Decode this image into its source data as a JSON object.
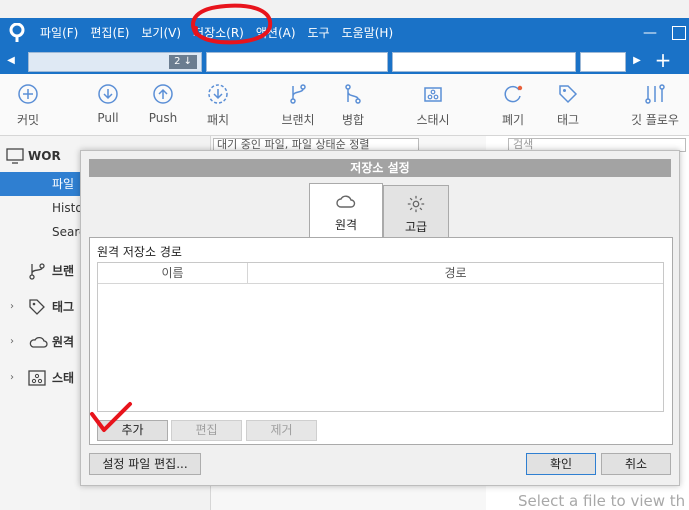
{
  "menu": [
    "파일(F)",
    "편집(E)",
    "보기(V)",
    "저장소(R)",
    "액션(A)",
    "도구",
    "도움말(H)"
  ],
  "window_controls": {
    "minimize": "—"
  },
  "tabs": {
    "pending_count": "2 ↓",
    "plus": "+"
  },
  "toolbar": [
    "커밋",
    "Pull",
    "Push",
    "패치",
    "브랜치",
    "병합",
    "스태시",
    "폐기",
    "태그",
    "깃 플로우"
  ],
  "sidebar": {
    "items": [
      {
        "label": "WOR",
        "selected": false
      },
      {
        "label": "파일",
        "selected": true
      },
      {
        "label": "Histo",
        "selected": false
      },
      {
        "label": "Searc",
        "selected": false
      },
      {
        "label": "브랜",
        "selected": false
      },
      {
        "label": "태그",
        "selected": false
      },
      {
        "label": "원격",
        "selected": false
      },
      {
        "label": "스태",
        "selected": false
      }
    ]
  },
  "main": {
    "filter_text": "대기 중인 파일, 파일 상태순 정렬",
    "search_placeholder": "검색",
    "select_hint": "Select a file to view th"
  },
  "dialog": {
    "title": "저장소 설정",
    "tabs": [
      {
        "label": "원격",
        "active": true
      },
      {
        "label": "고급",
        "active": false
      }
    ],
    "panel_label": "원격 저장소 경로",
    "columns": [
      "이름",
      "경로"
    ],
    "buttons": {
      "add": "추가",
      "edit": "편집",
      "remove": "제거",
      "edit_config": "설정 파일 편집...",
      "ok": "확인",
      "cancel": "취소"
    }
  },
  "colors": {
    "accent": "#1a72c7",
    "selection": "#2f7fd1",
    "annotation": "#e8141c"
  }
}
